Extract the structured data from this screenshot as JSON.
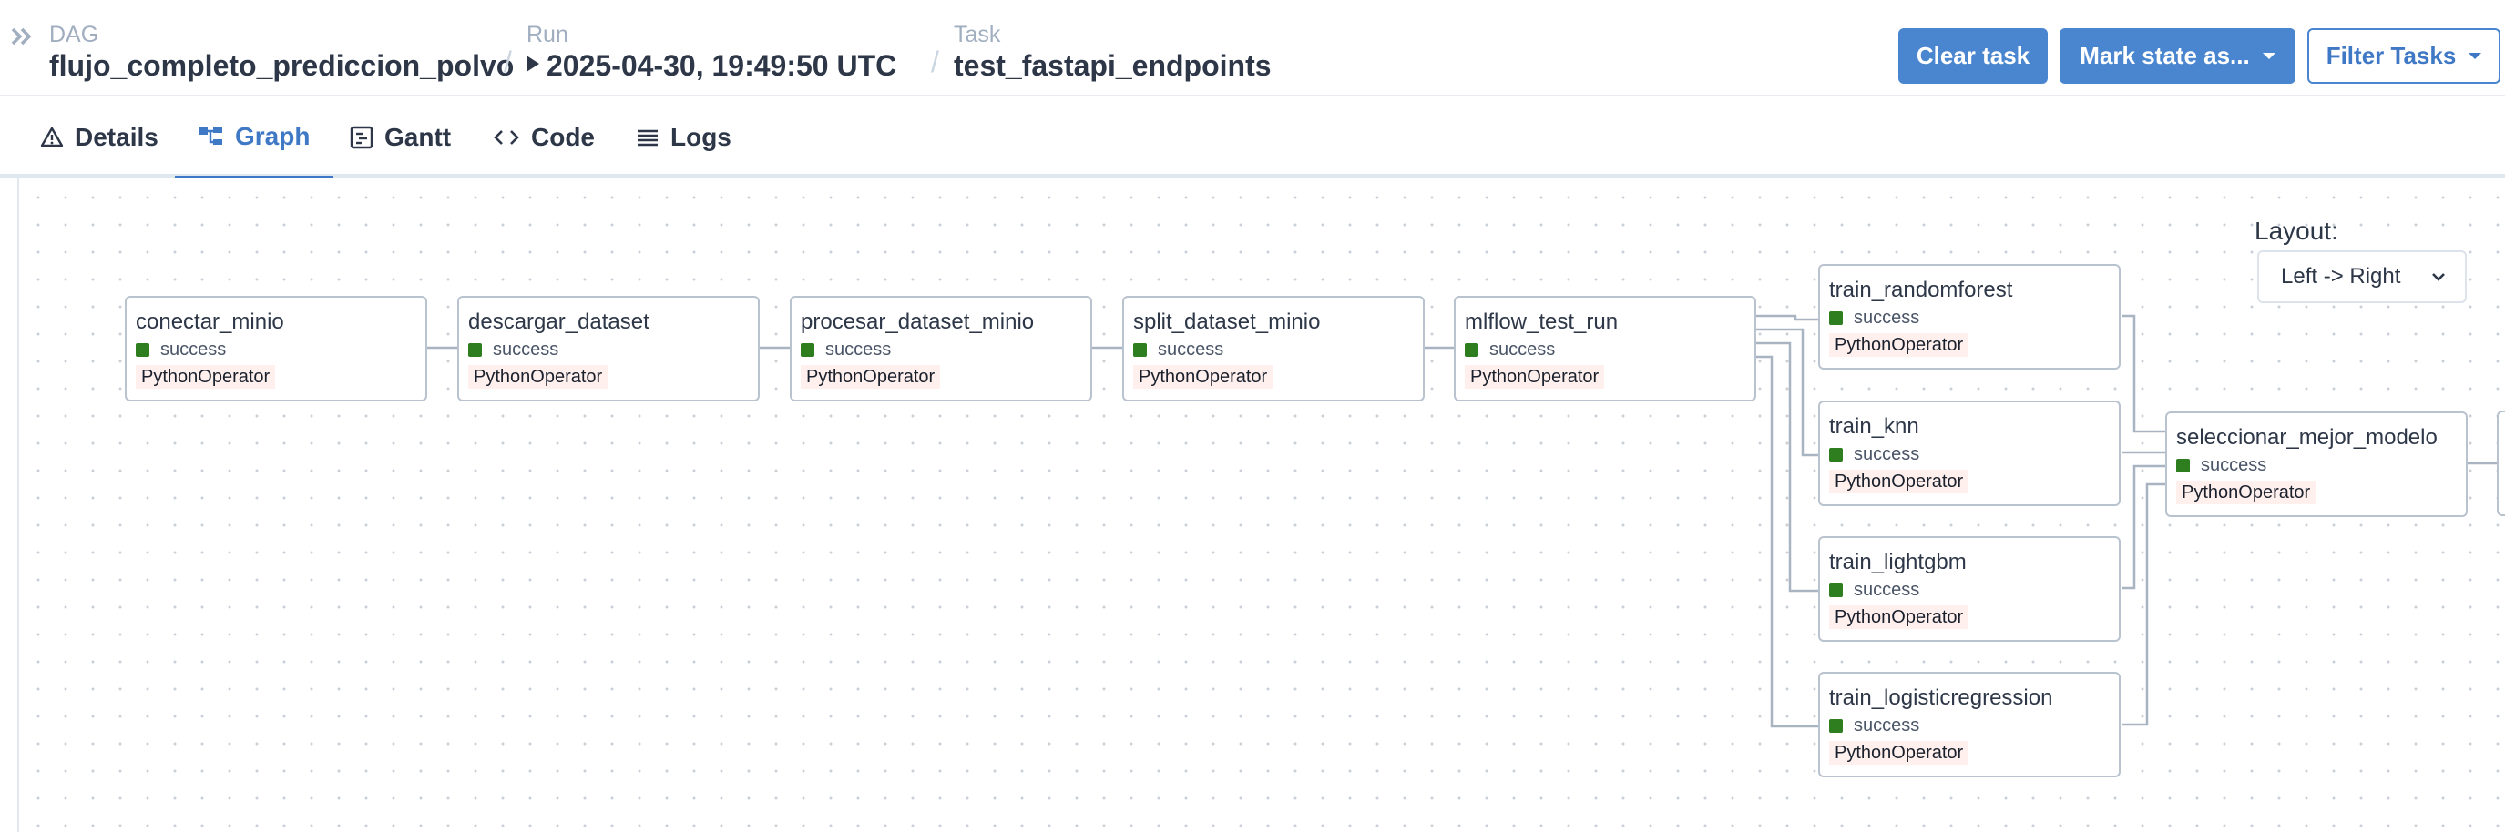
{
  "header": {
    "dag_label": "DAG",
    "dag_value": "flujo_completo_prediccion_polvo",
    "run_label": "Run",
    "run_value": "2025-04-30, 19:49:50 UTC",
    "task_label": "Task",
    "task_value": "test_fastapi_endpoints",
    "separator": "/",
    "clear_task": "Clear task",
    "mark_state": "Mark state as...",
    "filter_tasks": "Filter Tasks"
  },
  "tabs": [
    {
      "label": "Details",
      "icon": "warning-triangle-icon"
    },
    {
      "label": "Graph",
      "icon": "graph-icon",
      "active": true
    },
    {
      "label": "Gantt",
      "icon": "gantt-icon"
    },
    {
      "label": "Code",
      "icon": "code-icon"
    },
    {
      "label": "Logs",
      "icon": "list-icon"
    }
  ],
  "layout": {
    "label": "Layout:",
    "selected": "Left -> Right"
  },
  "nodes": [
    {
      "name": "conectar_minio",
      "state": "success",
      "operator": "PythonOperator"
    },
    {
      "name": "descargar_dataset",
      "state": "success",
      "operator": "PythonOperator"
    },
    {
      "name": "procesar_dataset_minio",
      "state": "success",
      "operator": "PythonOperator"
    },
    {
      "name": "split_dataset_minio",
      "state": "success",
      "operator": "PythonOperator"
    },
    {
      "name": "mlflow_test_run",
      "state": "success",
      "operator": "PythonOperator"
    },
    {
      "name": "train_randomforest",
      "state": "success",
      "operator": "PythonOperator"
    },
    {
      "name": "train_knn",
      "state": "success",
      "operator": "PythonOperator"
    },
    {
      "name": "train_lightgbm",
      "state": "success",
      "operator": "PythonOperator"
    },
    {
      "name": "train_logisticregression",
      "state": "success",
      "operator": "PythonOperator"
    },
    {
      "name": "seleccionar_mejor_modelo",
      "state": "success",
      "operator": "PythonOperator"
    }
  ],
  "colors": {
    "accent": "#3f78c4",
    "button": "#4a86cf",
    "success": "#2e7d1f",
    "operator_bg": "#fff0ee",
    "edge": "#a9b4c2"
  }
}
